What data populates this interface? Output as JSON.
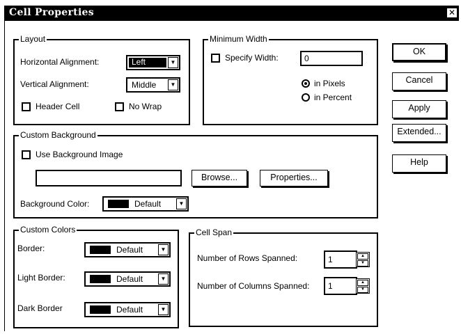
{
  "dialog": {
    "title": "Cell Properties",
    "close_glyph": "✕"
  },
  "layout": {
    "legend": "Layout",
    "horizontal_label": "Horizontal Alignment:",
    "horizontal_value": "Left",
    "vertical_label": "Vertical Alignment:",
    "vertical_value": "Middle",
    "header_cell_label": "Header Cell",
    "no_wrap_label": "No Wrap"
  },
  "min_width": {
    "legend": "Minimum Width",
    "specify_label": "Specify Width:",
    "width_value": "0",
    "pixels_label": "in Pixels",
    "percent_label": "in Percent",
    "selected_unit": "pixels"
  },
  "background": {
    "legend": "Custom Background",
    "use_image_label": "Use Background Image",
    "image_path": "",
    "browse_label": "Browse...",
    "properties_label": "Properties...",
    "color_label": "Background Color:",
    "color_value": "Default"
  },
  "colors": {
    "legend": "Custom Colors",
    "border_label": "Border:",
    "border_value": "Default",
    "light_label": "Light Border:",
    "light_value": "Default",
    "dark_label": "Dark Border",
    "dark_value": "Default",
    "swatch_color": "#000000"
  },
  "cell_span": {
    "legend": "Cell Span",
    "rows_label": "Number of Rows Spanned:",
    "rows_value": "1",
    "cols_label": "Number of Columns Spanned:",
    "cols_value": "1"
  },
  "buttons": {
    "ok": "OK",
    "cancel": "Cancel",
    "apply": "Apply",
    "extended": "Extended...",
    "help": "Help"
  }
}
